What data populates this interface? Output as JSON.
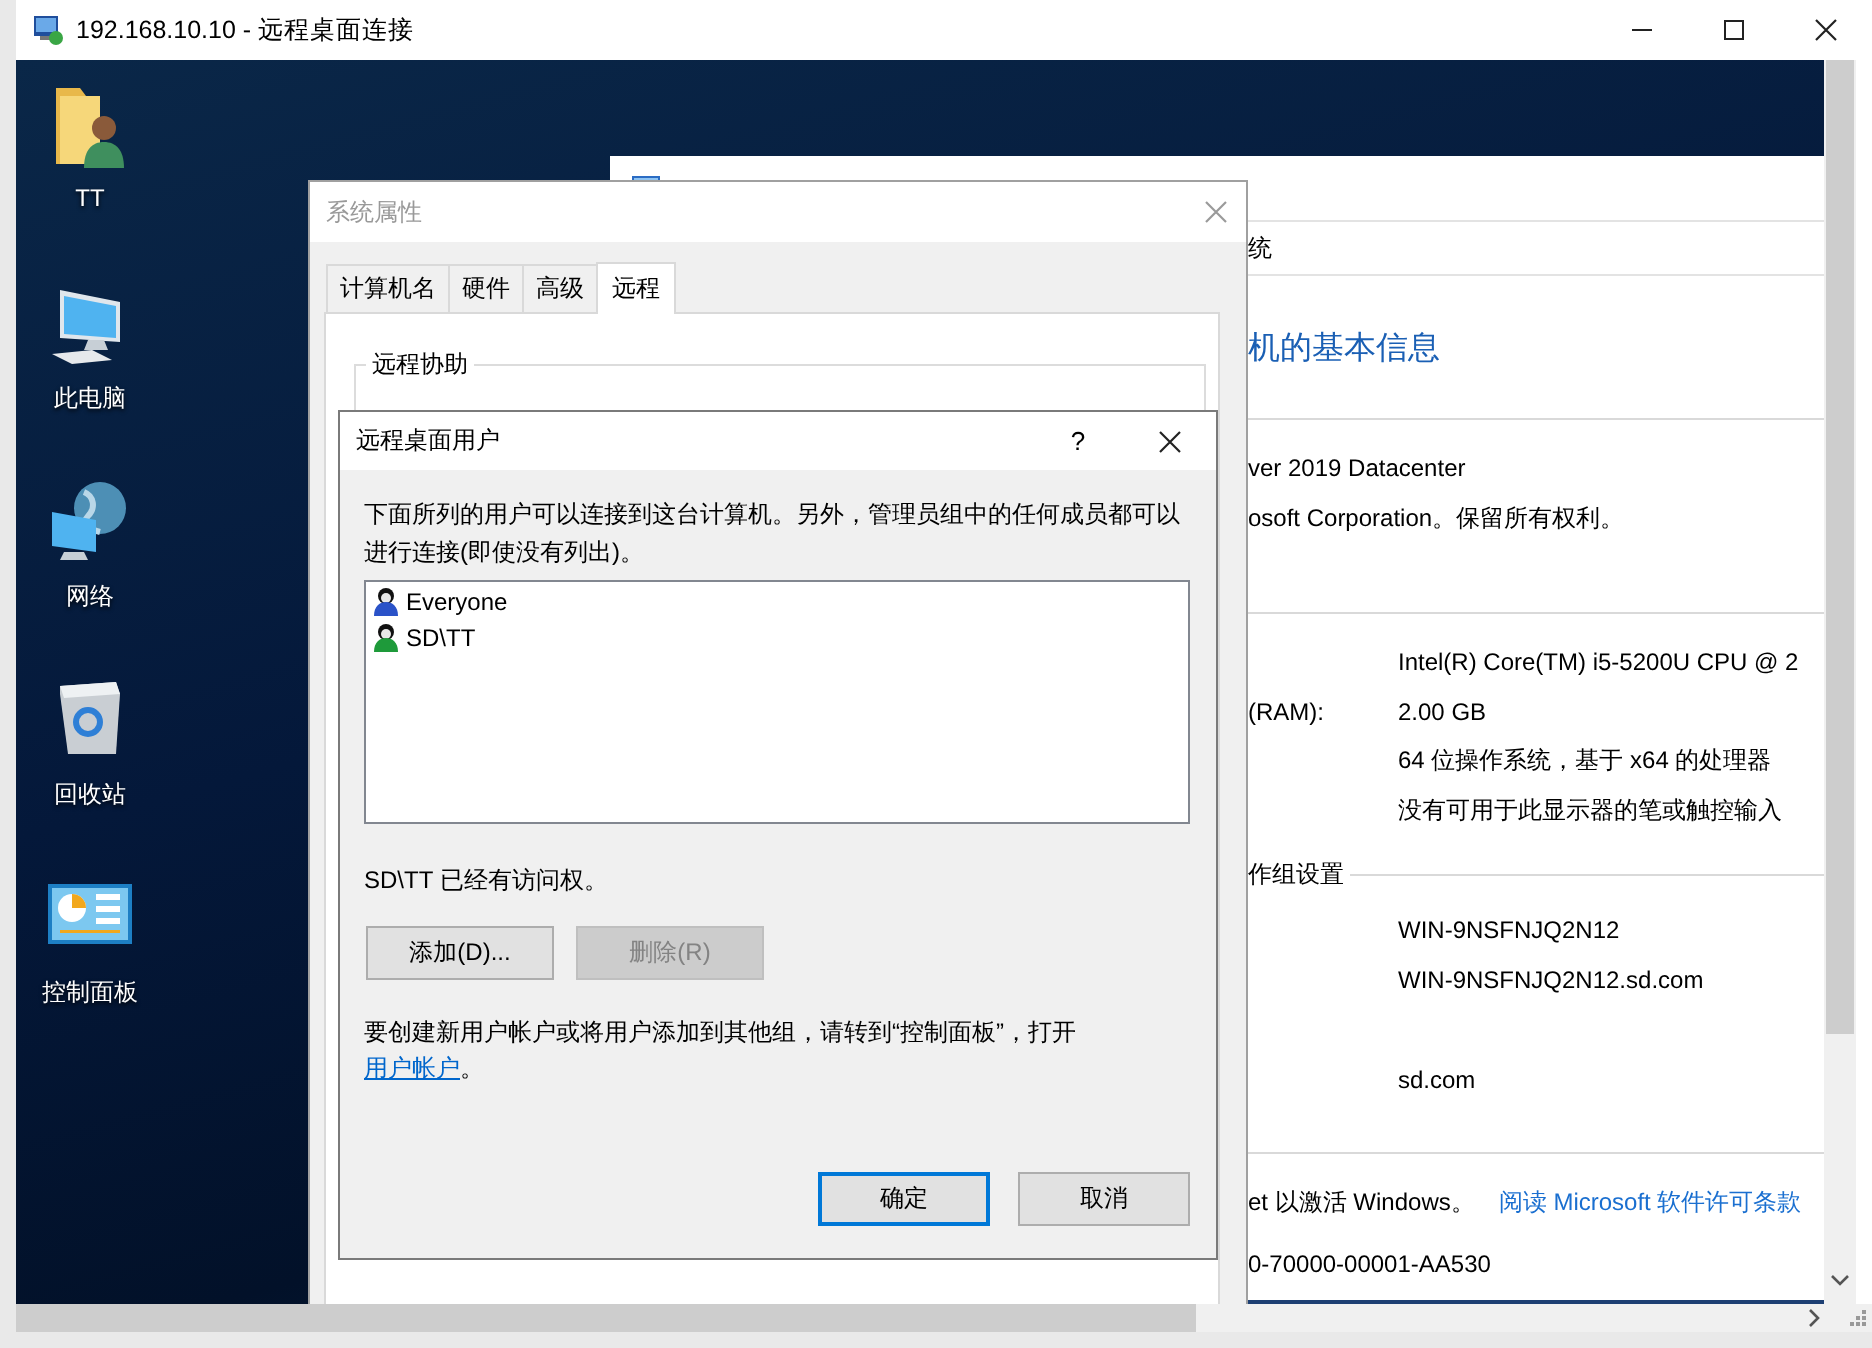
{
  "remote_desktop_window": {
    "title": "192.168.10.10 - 远程桌面连接"
  },
  "desktop_icons": [
    {
      "kind": "user-folder",
      "label": "TT"
    },
    {
      "kind": "computer",
      "label": "此电脑"
    },
    {
      "kind": "network",
      "label": "网络"
    },
    {
      "kind": "recycle-bin",
      "label": "回收站"
    },
    {
      "kind": "control-panel",
      "label": "控制面板"
    }
  ],
  "system_window": {
    "breadcrumb": "统",
    "heading": "机的基本信息",
    "edition": [
      "ver 2019 Datacenter",
      "osoft Corporation。保留所有权利。"
    ],
    "system_rows": [
      {
        "value": "Intel(R) Core(TM) i5-5200U CPU @ 2"
      },
      {
        "label": "(RAM):",
        "value": "2.00 GB"
      },
      {
        "value": "64 位操作系统，基于 x64 的处理器"
      },
      {
        "value": "没有可用于此显示器的笔或触控输入"
      }
    ],
    "section": "作组设置",
    "name_rows": [
      "WIN-9NSFNJQ2N12",
      "WIN-9NSFNJQ2N12.sd.com"
    ],
    "domain": "sd.com",
    "activation": "et 以激活 Windows。",
    "license_link": "阅读 Microsoft 软件许可条款",
    "product_id": "0-70000-00001-AA530"
  },
  "system_properties": {
    "title": "系统属性",
    "tabs": [
      {
        "label": "计算机名",
        "selected": false
      },
      {
        "label": "硬件",
        "selected": false
      },
      {
        "label": "高级",
        "selected": false
      },
      {
        "label": "远程",
        "selected": true
      }
    ],
    "group_title": "远程协助"
  },
  "remote_desktop_users": {
    "title": "远程桌面用户",
    "help": "?",
    "description": "下面所列的用户可以连接到这台计算机。另外，管理员组中的任何成员都可以进行连接(即使没有列出)。",
    "users": [
      {
        "kind": "group",
        "name": "Everyone"
      },
      {
        "kind": "user",
        "name": "SD\\TT"
      }
    ],
    "status": "SD\\TT 已经有访问权。",
    "buttons": [
      {
        "label": "添加(D)...",
        "disabled": false
      },
      {
        "label": "删除(R)",
        "disabled": true
      }
    ],
    "hint": "要创建新用户帐户或将用户添加到其他组，请转到“控制面板”，打开",
    "hint_link": "用户帐户",
    "hint_end": "。",
    "footer_buttons": [
      {
        "label": "确定",
        "default": true
      },
      {
        "label": "取消",
        "default": false
      }
    ]
  }
}
